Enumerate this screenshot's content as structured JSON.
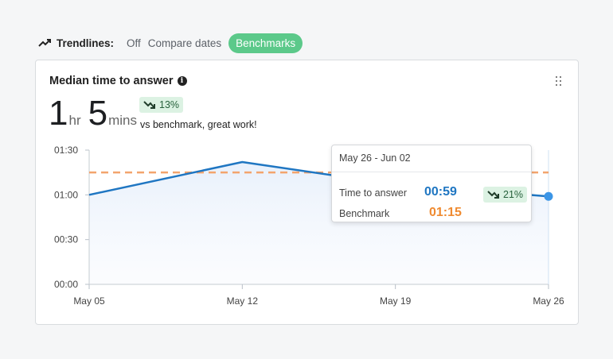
{
  "trendlines": {
    "label": "Trendlines:",
    "options": [
      "Off",
      "Compare dates",
      "Benchmarks"
    ],
    "active": "Benchmarks"
  },
  "card": {
    "title": "Median time to answer",
    "value_hours": "1",
    "unit_hours": "hr",
    "value_minutes": "5",
    "unit_minutes": "mins",
    "delta": "13%",
    "caption": "vs benchmark, great work!"
  },
  "tooltip": {
    "date_range": "May 26 - Jun 02",
    "metric_label": "Time to answer",
    "metric_value": "00:59",
    "benchmark_label": "Benchmark",
    "benchmark_value": "01:15",
    "delta": "21%"
  },
  "colors": {
    "line": "#1f76c2",
    "benchmark": "#f3a46d",
    "active_pill": "#5cc98a",
    "badge_bg": "#dcf2e3",
    "badge_text": "#27613c",
    "metric_value": "#1f76c2",
    "benchmark_value": "#ef8a30"
  },
  "chart_data": {
    "type": "line",
    "categories": [
      "May 05",
      "May 12",
      "May 19",
      "May 26"
    ],
    "y_ticks": [
      "00:00",
      "00:30",
      "01:00",
      "01:30"
    ],
    "ylim": [
      0,
      90
    ],
    "series": [
      {
        "values": [
          60,
          82,
          67,
          59
        ]
      }
    ],
    "benchmark": 75,
    "grid": false
  }
}
